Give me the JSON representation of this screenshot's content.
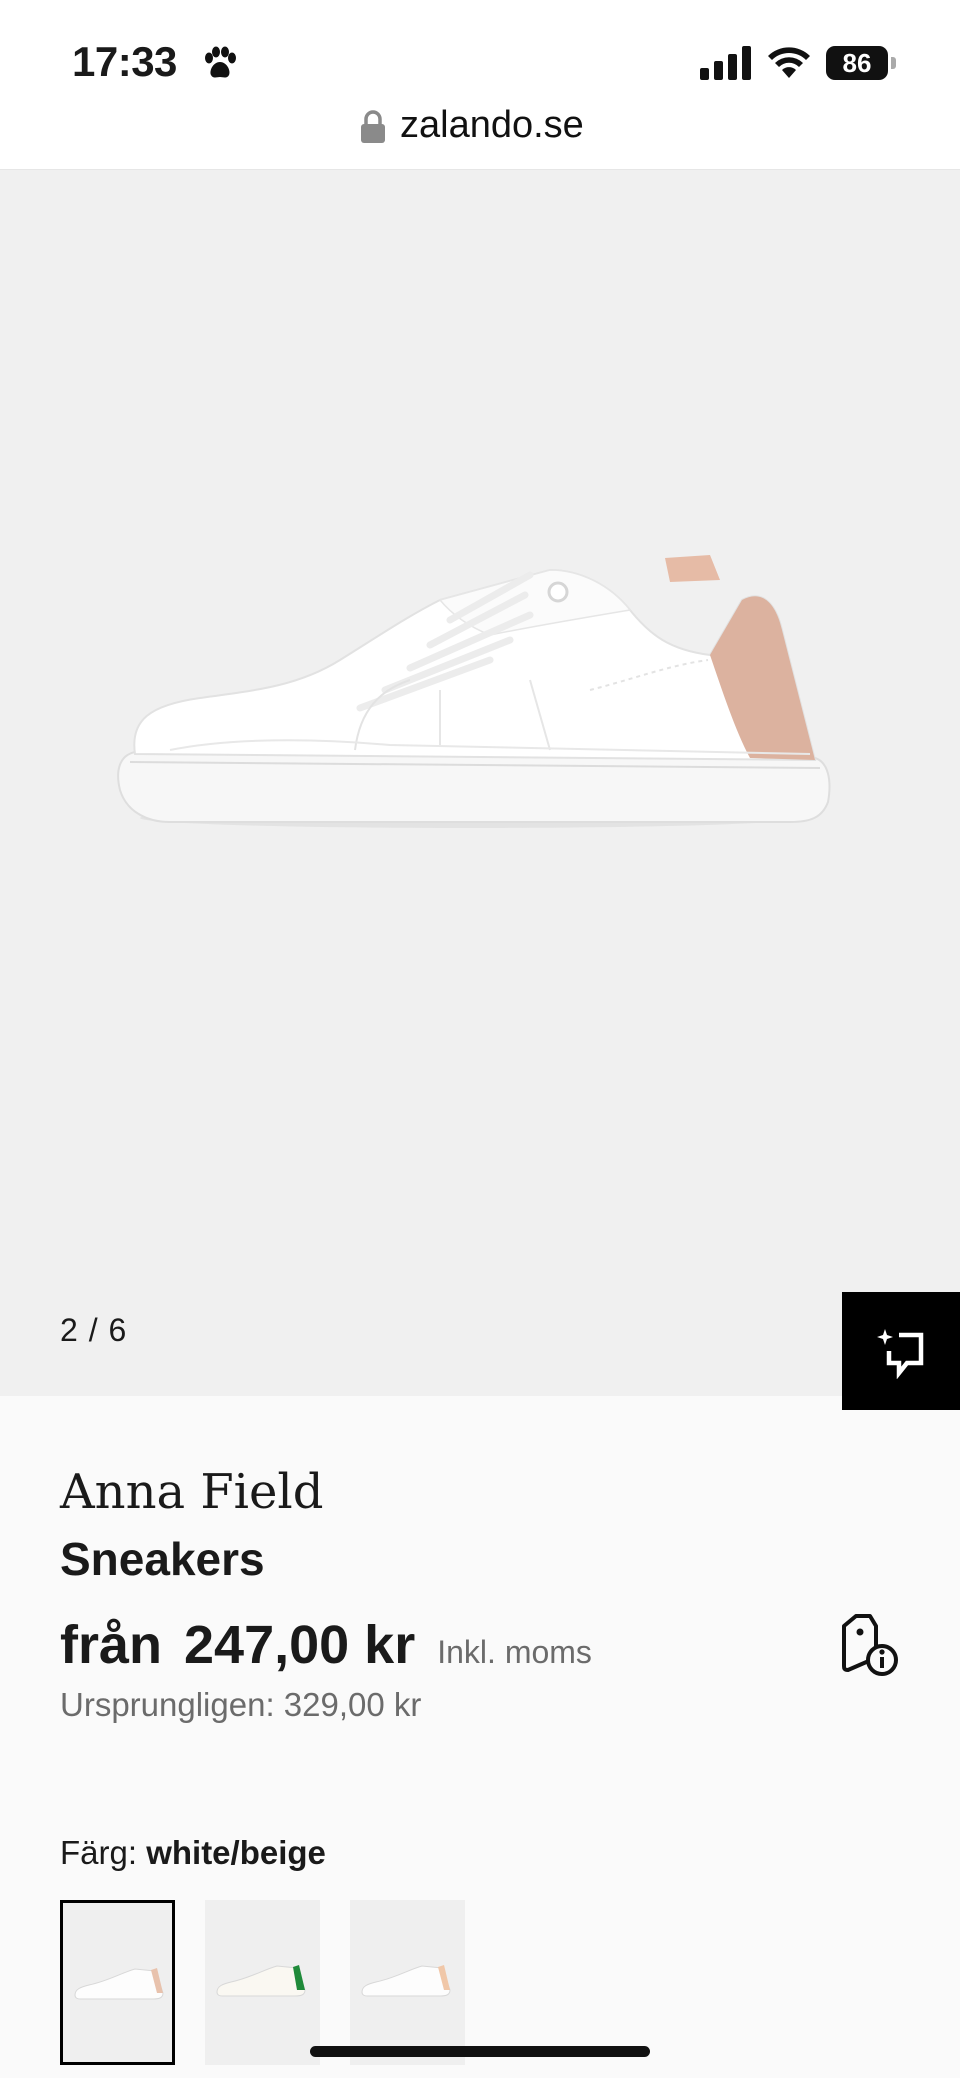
{
  "status_bar": {
    "time": "17:33",
    "battery": "86"
  },
  "address_bar": {
    "url": "zalando.se"
  },
  "gallery": {
    "page_indicator": "2 / 6"
  },
  "product": {
    "brand": "Anna Field",
    "name": "Sneakers",
    "price_prefix": "från",
    "price": "247,00 kr",
    "vat_note": "Inkl. moms",
    "original_price": "Ursprungligen: 329,00 kr"
  },
  "color": {
    "label": "Färg:",
    "value": "white/beige",
    "swatches": [
      {
        "accent": "#e8c2ad",
        "selected": true
      },
      {
        "accent": "#1f8a3a",
        "selected": false
      },
      {
        "accent": "#f0c7a8",
        "selected": false
      }
    ]
  },
  "colors": {
    "accent_heel": "#dcb29f",
    "gallery_bg": "#f0f0f0"
  }
}
